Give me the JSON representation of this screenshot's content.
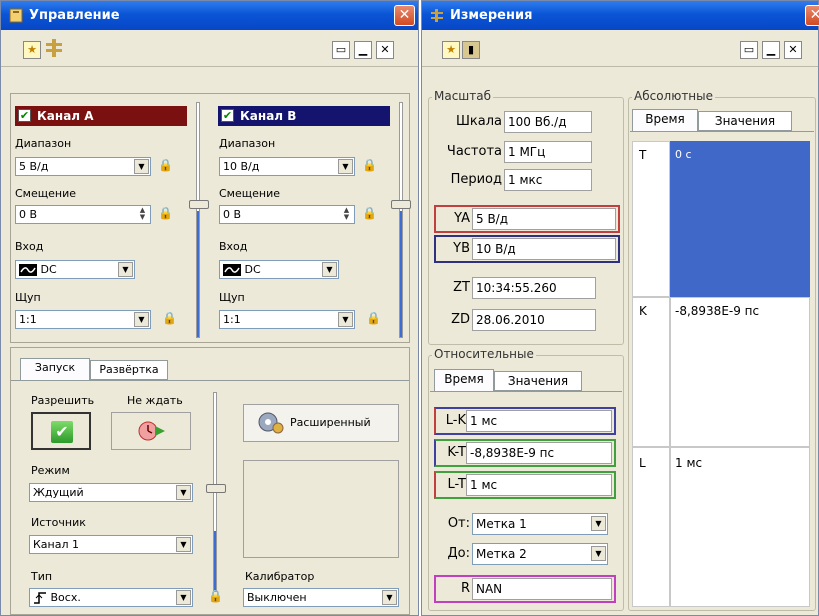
{
  "control": {
    "title": "Управление",
    "channel_a": {
      "label": "Канал A",
      "color": "#7a1010",
      "range_label": "Диапазон",
      "range": "5 В/д",
      "offset_label": "Смещение",
      "offset": "0 В",
      "input_label": "Вход",
      "input": "DC",
      "probe_label": "Щуп",
      "probe": "1:1"
    },
    "channel_b": {
      "label": "Канал B",
      "color": "#14146e",
      "range_label": "Диапазон",
      "range": "10 В/д",
      "offset_label": "Смещение",
      "offset": "0 В",
      "input_label": "Вход",
      "input": "DC",
      "probe_label": "Щуп",
      "probe": "1:1"
    },
    "tabs": [
      "Запуск",
      "Развёртка"
    ],
    "trigger": {
      "allow_label": "Разрешить",
      "nowait_label": "Не ждать",
      "advanced_label": "Расширенный",
      "mode_label": "Режим",
      "mode": "Ждущий",
      "source_label": "Источник",
      "source": "Канал 1",
      "type_label": "Тип",
      "type": "Восх.",
      "calibrator_label": "Калибратор",
      "calibrator": "Выключен"
    }
  },
  "measure": {
    "title": "Измерения",
    "scale_group": "Масштаб",
    "scale_label": "Шкала",
    "scale": "100 Вб./д",
    "freq_label": "Частота",
    "freq": "1 МГц",
    "period_label": "Период",
    "period": "1 мкс",
    "ya_label": "YA",
    "ya": "5 В/д",
    "ya_color": "#c04040",
    "yb_label": "YB",
    "yb": "10 В/д",
    "yb_color": "#303080",
    "zt_label": "ZT",
    "zt": "10:34:55.260",
    "zd_label": "ZD",
    "zd": "28.06.2010",
    "rel_group": "Относительные",
    "rel_tabs": [
      "Время",
      "Значения"
    ],
    "lk_label": "L-K",
    "lk": "1 мс",
    "kt_label": "K-T",
    "kt": "-8,8938E-9 пс",
    "lt_label": "L-T",
    "lt": "1 мс",
    "from_label": "От:",
    "from": "Метка 1",
    "to_label": "До:",
    "to": "Метка 2",
    "r_label": "R",
    "r": "NAN",
    "abs_group": "Абсолютные",
    "abs_tabs": [
      "Время",
      "Значения"
    ],
    "rows": [
      {
        "label": "T",
        "value": "0 с"
      },
      {
        "label": "K",
        "value": "-8,8938E-9 пс"
      },
      {
        "label": "L",
        "value": "1 мс"
      }
    ]
  }
}
